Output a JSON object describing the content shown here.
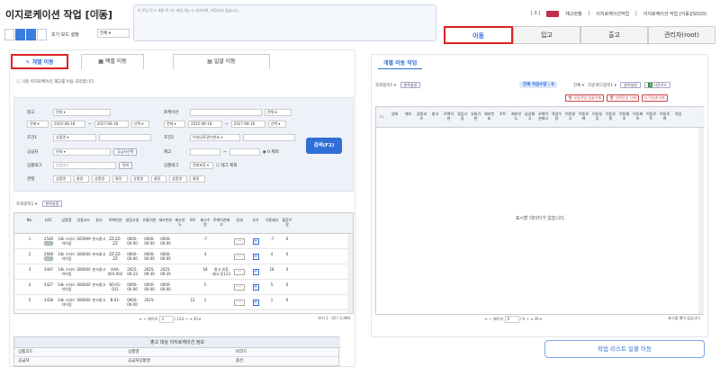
{
  "title": "이지로케이션 작업 [이동]",
  "memo_placeholder": "※ 로딩 로그 개발 로그는 제공기능 시 사라지며, 저장되지 않습니다.",
  "init_mode": {
    "label": "초기 모드 설정",
    "value": "전체"
  },
  "user_bar": {
    "user": "[ 0 ]",
    "menu1": "재고현황",
    "menu2": "이지로케이션작업",
    "page": "이지로케이션 작업 [이동](SD20)"
  },
  "header_tabs": [
    "이동",
    "입고",
    "출고",
    "관리자(root)"
  ],
  "sub_tabs": [
    "개별 이동",
    "엑셀 이동",
    "일괄 이동"
  ],
  "info_text": "기준 이지로케이션 재고를 이동 처리합니다.",
  "form": {
    "warehouse_label": "창고",
    "warehouse_value": "전체",
    "location_label": "로케이션",
    "location_value": "전체",
    "date_type": "전체",
    "date_from": "2025-08-18",
    "date_to": "2027-08-18",
    "date_btn": "선택",
    "date_type2": "전체",
    "date_from2": "2025-08-18",
    "date_to2": "2027-08-18",
    "date_btn2": "선택",
    "cond1_label": "조건1",
    "cond1_value": "상품명",
    "cond2_label": "조건2",
    "cond2_value": "이지LOC관리번호",
    "supplier_label": "공급처",
    "supplier_value": "전체",
    "supplier_btn": "공급처선택",
    "stock_label": "재고",
    "stock_check": "0 제외",
    "tag_label": "상품태그",
    "tag_placeholder": "상품태그",
    "tag_btn": "편의",
    "tag2_label": "상품태그",
    "tag2_value": "전체포함",
    "tag2_check": "태그 제외",
    "path_label": "경렬",
    "path_options": [
      "상품명",
      "물량",
      "상품명",
      "물량",
      "상품명",
      "물량",
      "상품명",
      "물량"
    ],
    "search_btn": "검색(F2)"
  },
  "left_tool": {
    "label": "조회항목1",
    "btn": "항목설정"
  },
  "left_table": {
    "headers": [
      "No.",
      "LOC",
      "상품명",
      "상품코드",
      "창고",
      "로케이션",
      "실입고일",
      "유통기한",
      "제조번호",
      "제조연도",
      "로트",
      "재고수량",
      "로케이션재고",
      "상세",
      "추가",
      "가용재고",
      "출장수량"
    ],
    "rows": [
      {
        "no": "1",
        "loc": "2546",
        "badge": "LOC",
        "name": "14k 스터드 이어링",
        "code": "S05999",
        "wh": "본사창고",
        "locn": "ZZ-ZZ-ZZ",
        "d1": "0000-00-00",
        "d2": "0000-00-00",
        "d3": "0000-00-00",
        "lot": "",
        "qty": "-7",
        "lstock": "",
        "avail": "-7",
        "out": "0"
      },
      {
        "no": "2",
        "loc": "2668",
        "badge": "LOC",
        "name": "14k 스터드 이어링",
        "code": "S06000",
        "wh": "본사창고",
        "locn": "ZZ-ZZ-ZZ",
        "d1": "0000-00-00",
        "d2": "0000-00-00",
        "d3": "0000-00-00",
        "lot": "",
        "qty": "4",
        "lstock": "",
        "avail": "4",
        "out": "0"
      },
      {
        "no": "3",
        "loc": "3407",
        "badge": "",
        "name": "14k 스터드 이어링",
        "code": "S06000",
        "wh": "본사창고",
        "locn": "AAA-001-002",
        "d1": "2025-09-23",
        "d2": "2025-09-30",
        "d3": "2025-09-26",
        "lot": "",
        "qty": "18",
        "lstock": "창고 유휴 재고 동113",
        "avail": "18",
        "out": "0"
      },
      {
        "no": "4",
        "loc": "3427",
        "badge": "",
        "name": "14k 스터드 이어링",
        "code": "S06000",
        "wh": "본사창고",
        "locn": "B0-01-011",
        "d1": "0000-00-00",
        "d2": "0000-00-00",
        "d3": "0000-00-00",
        "lot": "",
        "qty": "5",
        "lstock": "",
        "avail": "5",
        "out": "0"
      },
      {
        "no": "5",
        "loc": "3428",
        "badge": "",
        "name": "14k 스터드 이어링",
        "code": "S06000",
        "wh": "본사창고",
        "locn": "B-01-",
        "d1": "0000-00-00",
        "d2": "2025-",
        "d3": "",
        "lot": "12",
        "qty": "1",
        "lstock": "",
        "avail": "1",
        "out": "0"
      }
    ],
    "pager": {
      "page_label": "페이지",
      "page": "1",
      "total": "/ 124",
      "size": "30",
      "summary": "보기 1 - 20 / 2,466"
    }
  },
  "bottom_section": {
    "title": "출고 대상 이지로케이션 정보",
    "row1": [
      "상품코드",
      "상품명",
      "바코드"
    ],
    "row2": [
      "공급처",
      "공급처상품명",
      "옵션"
    ]
  },
  "right": {
    "tab": "개별 이동 작업",
    "tool_label": "조회항목1",
    "tool_btn": "항목설정",
    "count_label": "전체 작업수량 : 0",
    "filter_value": "전체",
    "download_label": "다운로드항목1",
    "item_btn": "항목설정",
    "excel_btn": "다운로드",
    "del_sel_btn": "오류작업 일괄삭제",
    "del_btn": "선택작업 삭제",
    "reset_btn": "작업초기화",
    "headers": [
      "상태",
      "에러",
      "상품코드",
      "창고",
      "로케이션",
      "실입고일",
      "유통기한",
      "제조번호",
      "로트",
      "제조연도",
      "남김재고",
      "로케이션재고",
      "작업수량",
      "이동창고",
      "이동로케",
      "이동실입",
      "이동유통",
      "이동제조",
      "이동제조",
      "이동로트",
      "이동로케",
      "작업"
    ],
    "empty": "표시할 데이터가 없습니다.",
    "pager": {
      "page_label": "페이지",
      "page": "0",
      "total": "/ 0",
      "size": "30",
      "summary": "표시할 행이 없습니다"
    }
  },
  "bulk_btn": "작업 리스트 일괄 이동"
}
